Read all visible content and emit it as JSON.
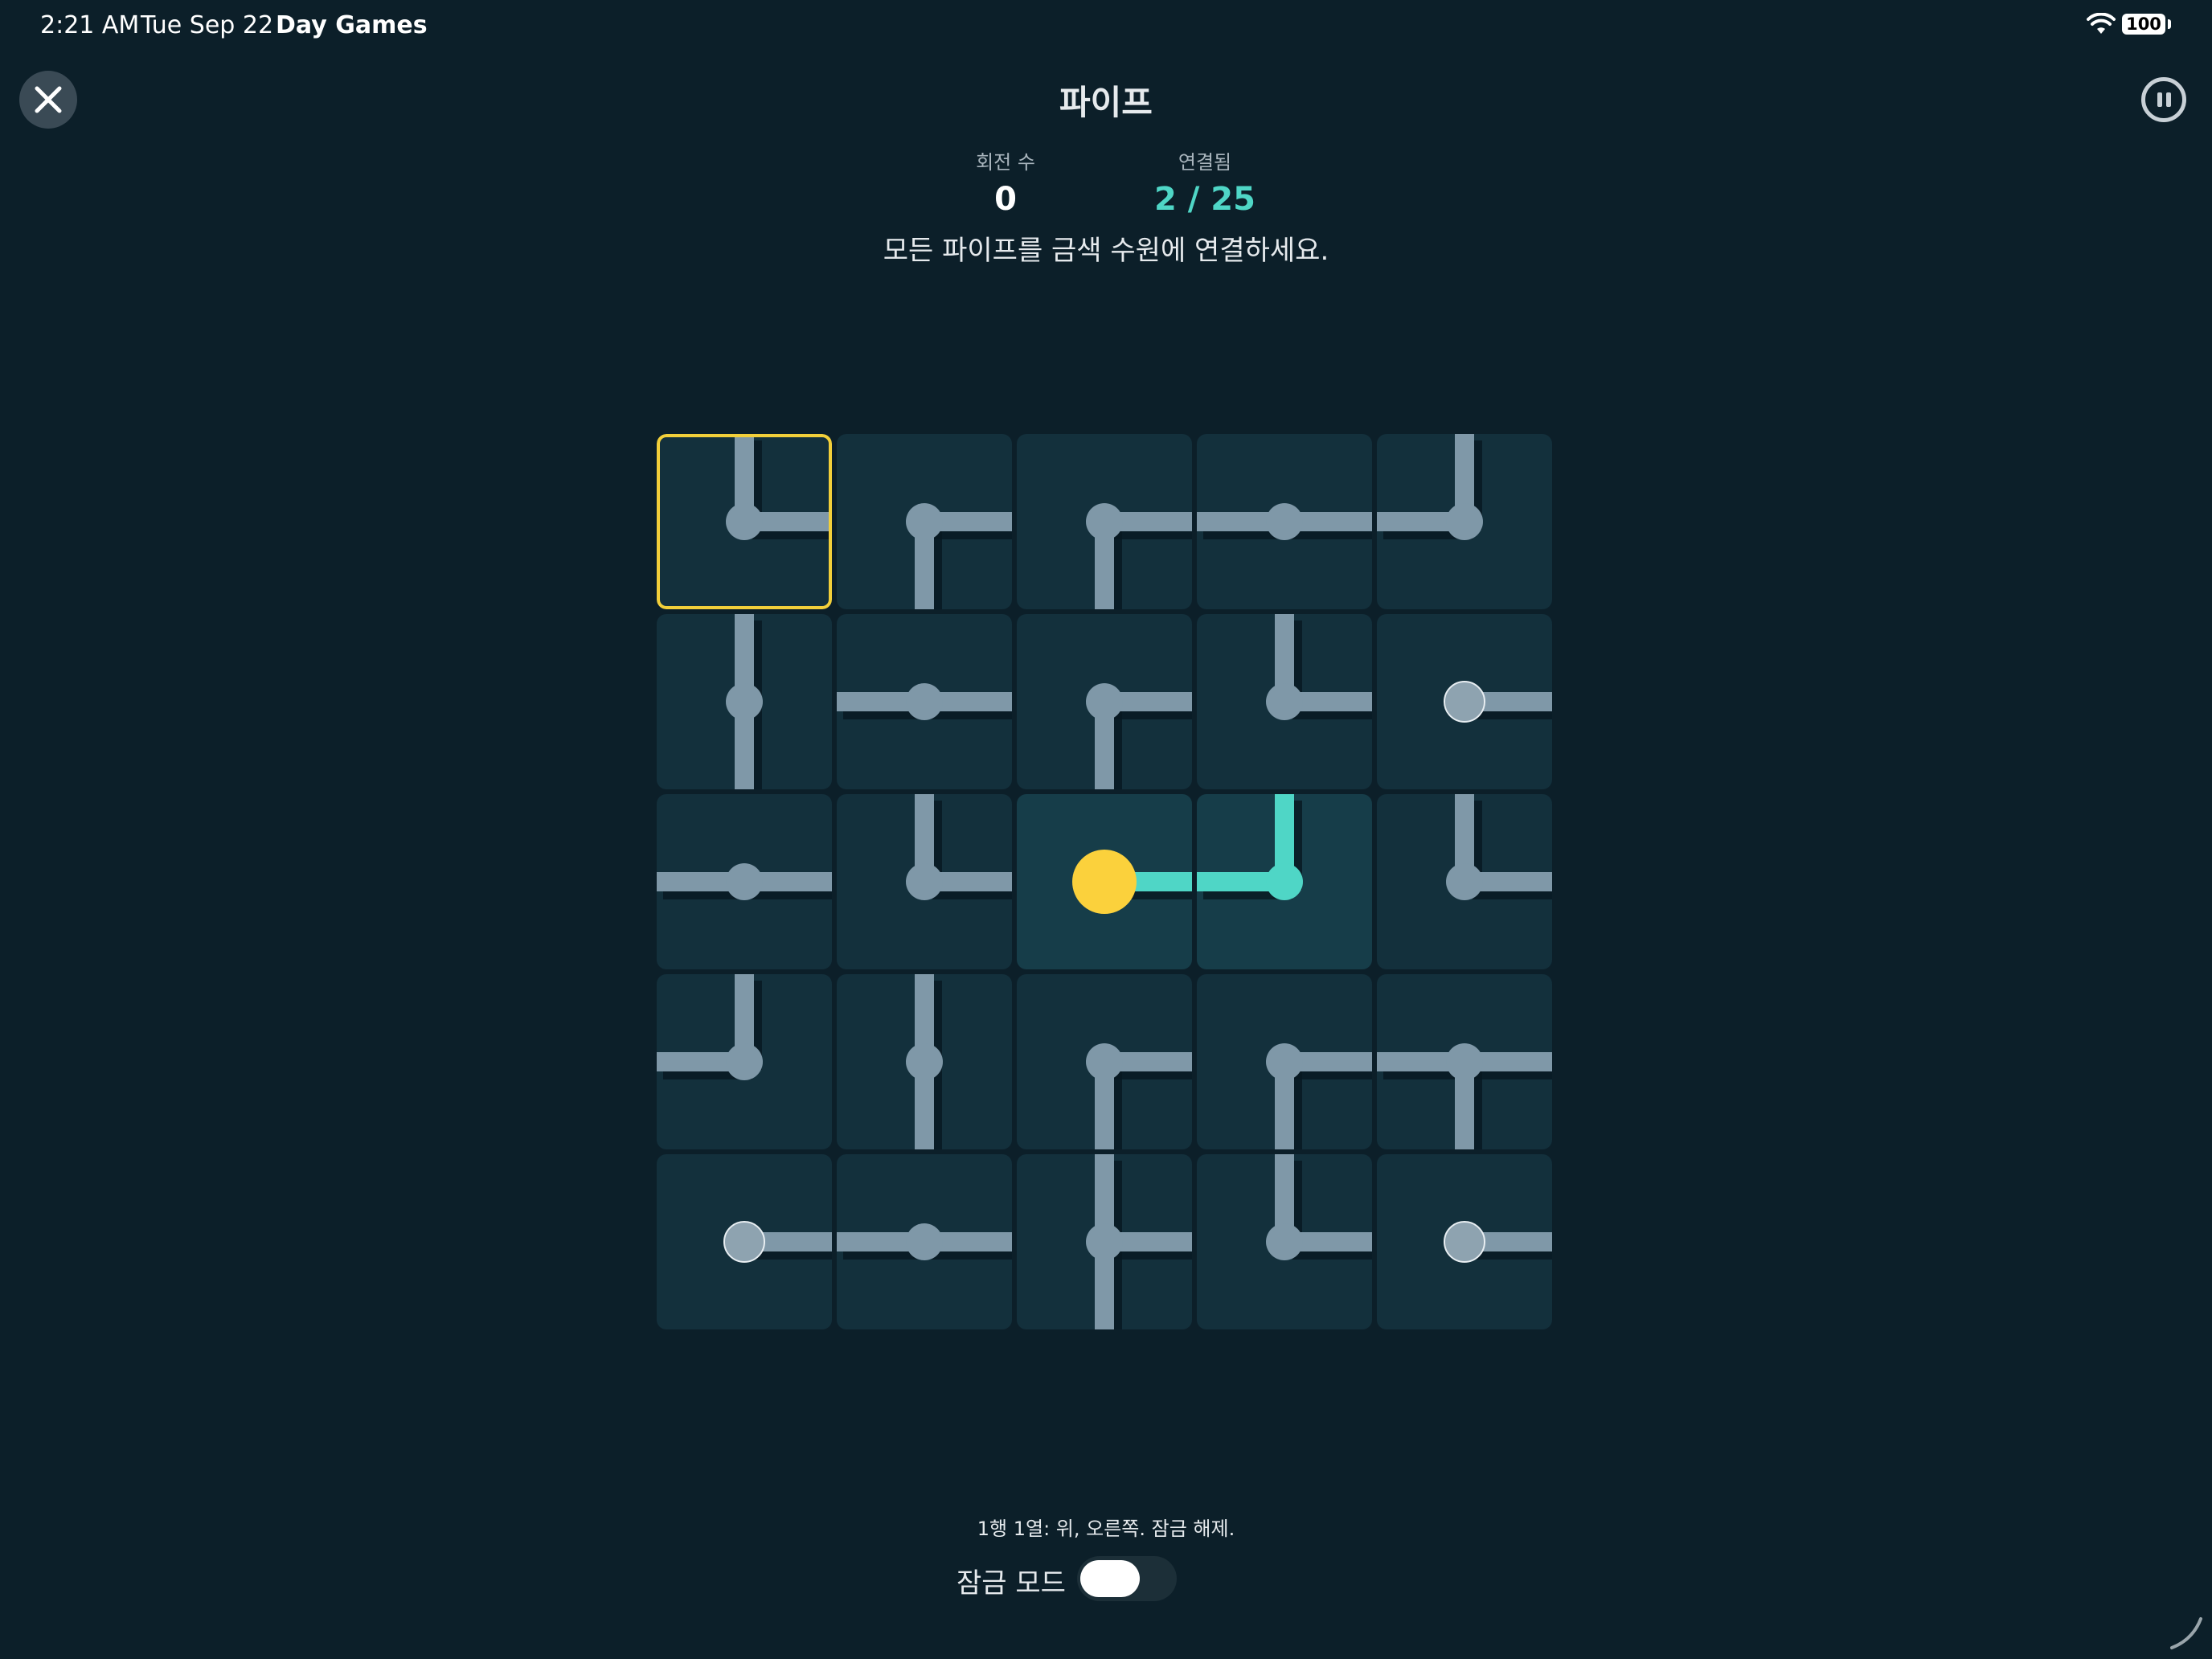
{
  "status_bar": {
    "time": "2:21 AM",
    "date": "Tue Sep 22",
    "app": "Day Games",
    "battery": "100"
  },
  "header": {
    "title": "파이프",
    "close_icon": "close-icon",
    "pause_icon": "pause-icon"
  },
  "stats": {
    "rotations_label": "회전 수",
    "rotations_value": "0",
    "connected_label": "연결됨",
    "connected_value": "2 / 25"
  },
  "instruction": "모든 파이프를 금색 수원에 연결하세요.",
  "board": {
    "rows": 5,
    "cols": 5,
    "selected": [
      0,
      0
    ],
    "source": [
      2,
      2
    ],
    "colors": {
      "pipe": "#7f98a8",
      "pipe_connected": "#4fd6c6",
      "source": "#fbd13c",
      "selection": "#f2cf3a",
      "endpoint": "#8ea3b0"
    },
    "tiles": [
      [
        {
          "c": [
            "up",
            "right"
          ]
        },
        {
          "c": [
            "right",
            "down"
          ]
        },
        {
          "c": [
            "right",
            "down"
          ]
        },
        {
          "c": [
            "left",
            "right"
          ]
        },
        {
          "c": [
            "up",
            "left"
          ]
        }
      ],
      [
        {
          "c": [
            "up",
            "down"
          ]
        },
        {
          "c": [
            "left",
            "right"
          ]
        },
        {
          "c": [
            "right",
            "down"
          ]
        },
        {
          "c": [
            "up",
            "right"
          ]
        },
        {
          "c": [
            "right"
          ],
          "end": true
        }
      ],
      [
        {
          "c": [
            "left",
            "right"
          ]
        },
        {
          "c": [
            "up",
            "right"
          ]
        },
        {
          "c": [
            "right"
          ],
          "source": true,
          "lit": true
        },
        {
          "c": [
            "up",
            "left"
          ],
          "lit": true
        },
        {
          "c": [
            "up",
            "right"
          ]
        }
      ],
      [
        {
          "c": [
            "up",
            "left"
          ]
        },
        {
          "c": [
            "up",
            "down"
          ]
        },
        {
          "c": [
            "right",
            "down"
          ]
        },
        {
          "c": [
            "right",
            "down"
          ]
        },
        {
          "c": [
            "left",
            "right",
            "down"
          ]
        }
      ],
      [
        {
          "c": [
            "right"
          ],
          "end": true
        },
        {
          "c": [
            "left",
            "right"
          ]
        },
        {
          "c": [
            "up",
            "right",
            "down"
          ]
        },
        {
          "c": [
            "up",
            "right"
          ]
        },
        {
          "c": [
            "right"
          ],
          "end": true
        }
      ]
    ]
  },
  "footer": {
    "status": "1행 1열: 위, 오른쪽. 잠금 해제.",
    "lock_label": "잠금 모드",
    "lock_on": false
  }
}
